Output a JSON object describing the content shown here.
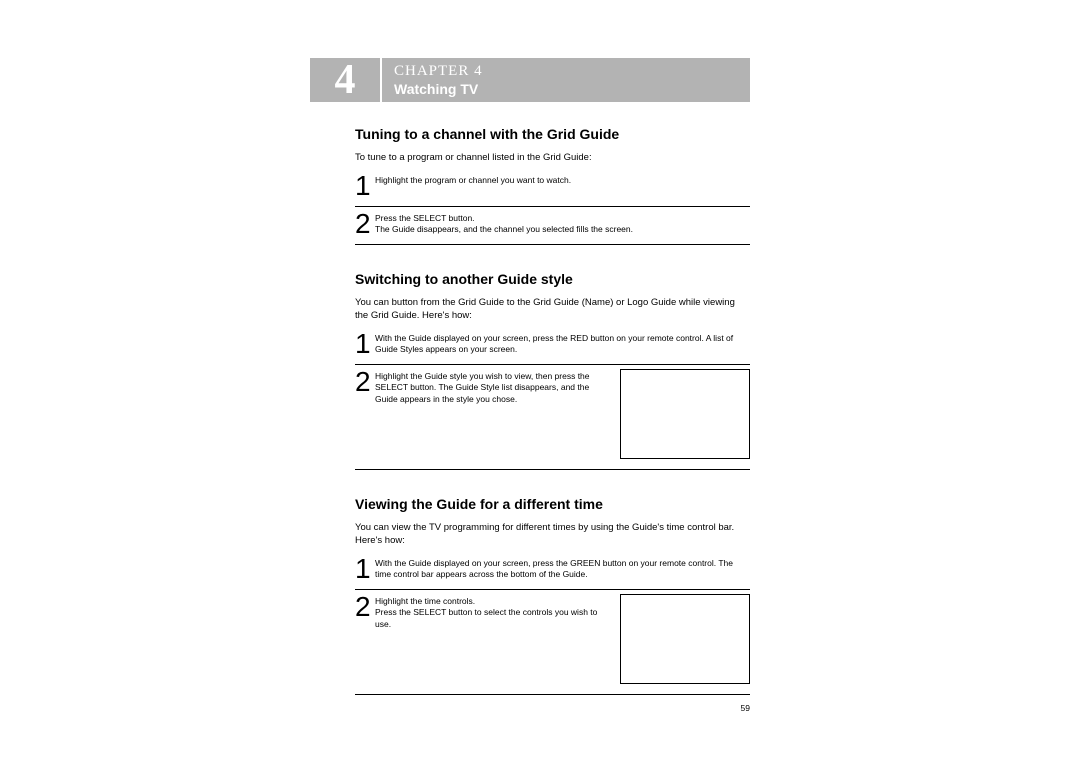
{
  "chapter": {
    "number": "4",
    "label": "CHAPTER 4",
    "subtitle": "Watching TV"
  },
  "section1": {
    "heading": "Tuning to a channel with the Grid Guide",
    "intro": "To tune to a program or channel listed in the Grid Guide:",
    "step1num": "1",
    "step1text": "Highlight the program or channel you want to watch.",
    "step2num": "2",
    "step2text": "Press the SELECT button.\nThe Guide disappears, and the channel you selected fills the screen."
  },
  "section2": {
    "heading": "Switching to another Guide style",
    "intro": "You can button from the Grid Guide to the Grid Guide (Name) or Logo Guide while viewing the Grid Guide. Here's how:",
    "step1num": "1",
    "step1text": "With the Guide displayed on your screen, press the RED button on your remote control. A list of Guide Styles appears on your screen.",
    "step2num": "2",
    "step2text": "Highlight the Guide style you wish to view, then press the SELECT button. The Guide Style list disappears, and the Guide appears in the style you chose."
  },
  "section3": {
    "heading": "Viewing the Guide for a different time",
    "intro": "You can view the TV programming for different times by using the Guide's time control bar. Here's how:",
    "step1num": "1",
    "step1text": "With the Guide displayed on your screen, press the GREEN button on your remote control. The time control bar appears across the bottom of the Guide.",
    "step2num": "2",
    "step2text": "Highlight the time controls.\nPress the SELECT button to select the controls you wish to use."
  },
  "pageNumber": "59"
}
